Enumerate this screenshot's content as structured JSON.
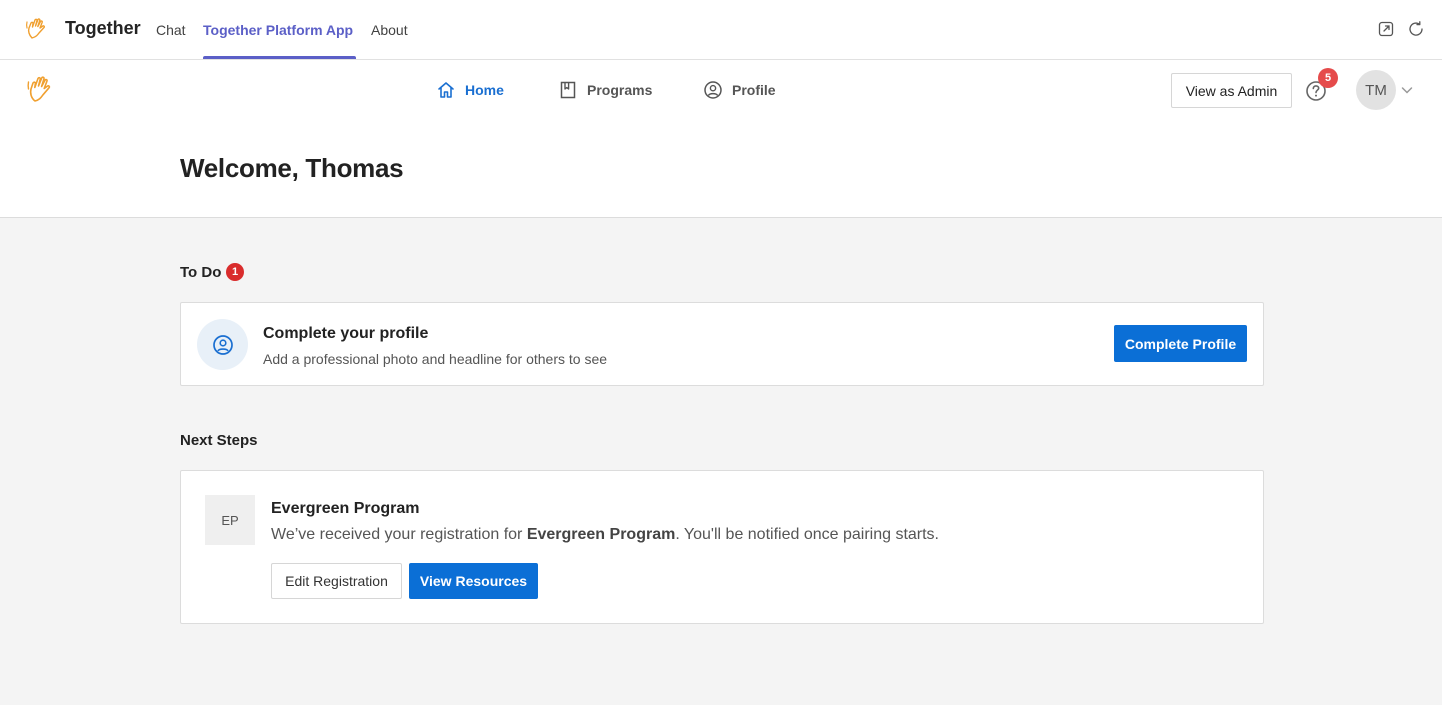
{
  "topbar": {
    "app_name": "Together",
    "tabs": [
      {
        "label": "Chat"
      },
      {
        "label": "Together Platform App",
        "active": true
      },
      {
        "label": "About"
      }
    ],
    "icons": [
      "wave-hand-icon",
      "popout-icon",
      "refresh-icon"
    ]
  },
  "header": {
    "nav": [
      {
        "label": "Home",
        "icon": "home-icon",
        "active": true
      },
      {
        "label": "Programs",
        "icon": "book-icon"
      },
      {
        "label": "Profile",
        "icon": "user-circle-icon"
      }
    ],
    "admin_button": "View as Admin",
    "help_badge": "5",
    "avatar_initials": "TM",
    "welcome": "Welcome, Thomas"
  },
  "todo": {
    "title": "To Do",
    "count": "1",
    "card": {
      "heading": "Complete your profile",
      "subtext": "Add a professional photo and headline for others to see",
      "button": "Complete Profile"
    }
  },
  "next_steps": {
    "title": "Next Steps",
    "program": {
      "initials": "EP",
      "name": "Evergreen Program",
      "desc_prefix": "We’ve received your registration for ",
      "desc_bold": "Evergreen Program",
      "desc_suffix": ". You'll be notified once pairing starts.",
      "edit_button": "Edit Registration",
      "resources_button": "View Resources"
    }
  },
  "colors": {
    "accent_teams": "#5b5fc7",
    "primary": "#0b6fd6",
    "badge_red": "#d92c2c",
    "logo_orange": "#f0a030"
  }
}
